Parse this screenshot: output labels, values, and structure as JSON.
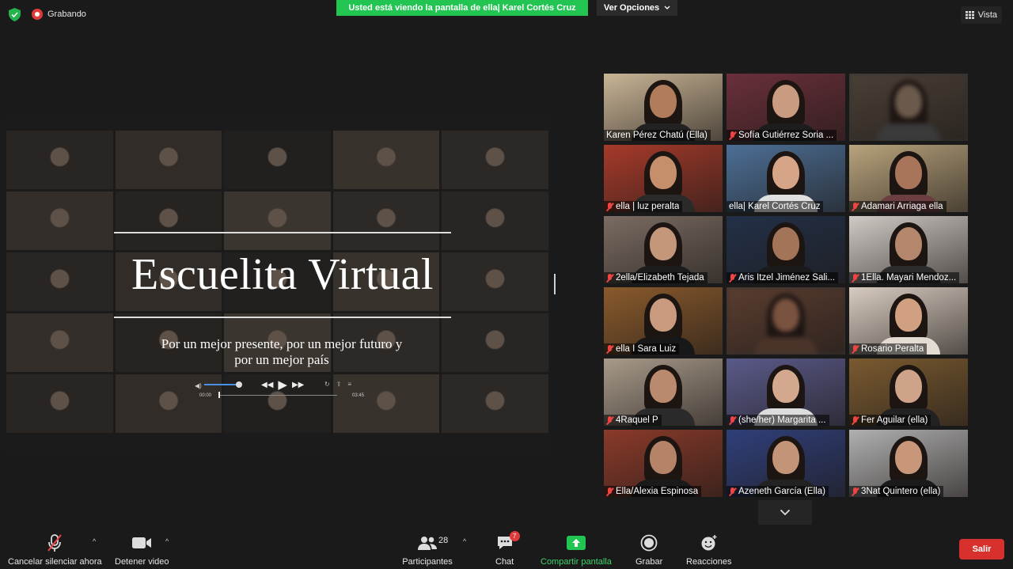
{
  "topbar": {
    "recording_label": "Grabando",
    "share_banner": "Usted está viendo la pantalla de ella| Karel Cortés Cruz",
    "view_options": "Ver Opciones",
    "view_label": "Vista"
  },
  "slide": {
    "title": "Escuelita Virtual",
    "subtitle_line1": "Por un mejor presente, por un mejor futuro y",
    "subtitle_line2": "por un mejor país",
    "time_start": "00:00",
    "time_end": "03:45"
  },
  "participants": [
    {
      "name": "Karen Pérez Chatú (Ella)",
      "muted": false,
      "bg": "#c9b596",
      "skin": "#b07c5c",
      "shirt": "#222"
    },
    {
      "name": "Sofía Gutiérrez Soria ...",
      "muted": true,
      "bg": "#6a2f3a",
      "skin": "#c99b80",
      "shirt": "#1d1d1d"
    },
    {
      "name": "",
      "muted": false,
      "bg": "#4a4036",
      "skin": "#6b5a4c",
      "shirt": "#3a3a3a",
      "blur": true
    },
    {
      "name": "ella | luz peralta",
      "muted": true,
      "bg": "#a63a2a",
      "skin": "#c58f6c",
      "shirt": "#2a2a2a"
    },
    {
      "name": "ella| Karel Cortés Cruz",
      "muted": false,
      "bg": "#4c6f96",
      "skin": "#d6a588",
      "shirt": "#e0e0e0",
      "active": true
    },
    {
      "name": "Adamari Arriaga ella",
      "muted": true,
      "bg": "#b8a37c",
      "skin": "#a8745a",
      "shirt": "#6b3e42"
    },
    {
      "name": "2ella/Elizabeth Tejada",
      "muted": true,
      "bg": "#7a6c62",
      "skin": "#c4967a",
      "shirt": "#1c1c1c"
    },
    {
      "name": "Aris Itzel Jiménez Sali...",
      "muted": true,
      "bg": "#223048",
      "skin": "#a37458",
      "shirt": "#1a1a1a"
    },
    {
      "name": "1Ella. Mayari Mendoz...",
      "muted": true,
      "bg": "#cfcac4",
      "skin": "#b4876c",
      "shirt": "#2c2c2c"
    },
    {
      "name": "ella I Sara Luiz",
      "muted": true,
      "bg": "#8a5a2c",
      "skin": "#c99a7d",
      "shirt": "#181818"
    },
    {
      "name": "",
      "muted": false,
      "bg": "#5a3d30",
      "skin": "#7a5240",
      "shirt": "#4a342a",
      "blur": true
    },
    {
      "name": "Rosario Peralta",
      "muted": true,
      "bg": "#d8ccc0",
      "skin": "#d0a080",
      "shirt": "#e4dcd2"
    },
    {
      "name": "4Raquel P",
      "muted": true,
      "bg": "#a89a8a",
      "skin": "#b98a6e",
      "shirt": "#2a2a2a"
    },
    {
      "name": "(she/her) Margarita ...",
      "muted": true,
      "bg": "#5a5a8a",
      "skin": "#d4a88e",
      "shirt": "#ddd"
    },
    {
      "name": "Fer Aguilar (ella)",
      "muted": true,
      "bg": "#7a5a30",
      "skin": "#cfa28a",
      "shirt": "#222"
    },
    {
      "name": "Ella/Alexia Espinosa",
      "muted": true,
      "bg": "#8a3a2a",
      "skin": "#b58468",
      "shirt": "#1a1a1a"
    },
    {
      "name": "Azeneth García (Ella)",
      "muted": true,
      "bg": "#2f3f7a",
      "skin": "#c49478",
      "shirt": "#222"
    },
    {
      "name": "3Nat Quintero (ella)",
      "muted": true,
      "bg": "#b0b0b0",
      "skin": "#c8977a",
      "shirt": "#1b1b1b"
    }
  ],
  "toolbar": {
    "unmute_label": "Cancelar silenciar ahora",
    "video_label": "Detener video",
    "participants_label": "Participantes",
    "participants_count": "28",
    "chat_label": "Chat",
    "chat_badge": "7",
    "share_label": "Compartir pantalla",
    "record_label": "Grabar",
    "reactions_label": "Reacciones",
    "leave_label": "Salir"
  }
}
